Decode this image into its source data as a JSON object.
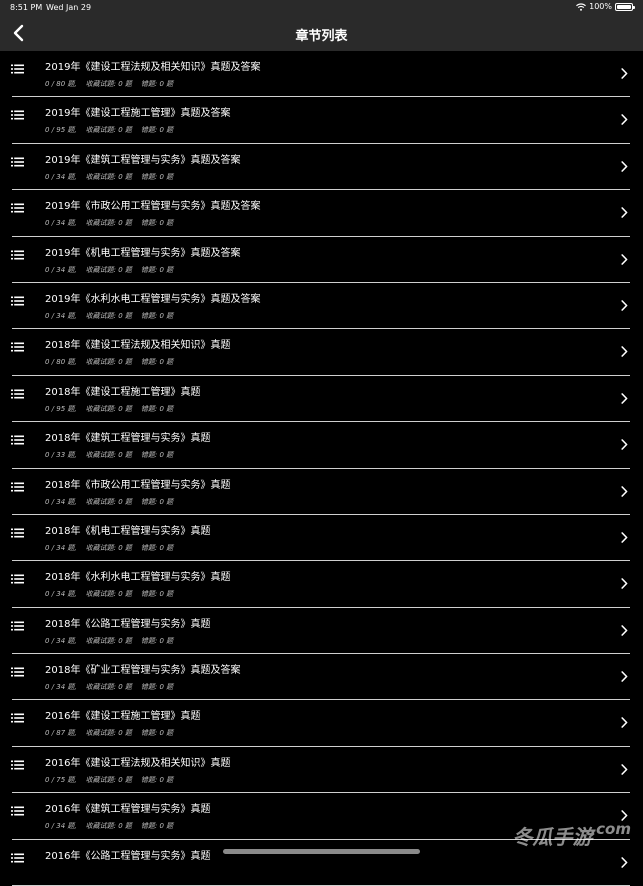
{
  "status_bar": {
    "time": "8:51 PM",
    "date": "Wed Jan 29",
    "battery": "100%",
    "battery_level": 1.0,
    "wifi_icon": "wifi-icon"
  },
  "nav": {
    "title": "章节列表",
    "back_icon": "chevron-left-icon"
  },
  "chapters": [
    {
      "title": "2019年《建设工程法规及相关知识》真题及答案",
      "progress": "0 / 80 题,",
      "favorites": "收藏试题: 0 题",
      "wrong": "错题: 0 题"
    },
    {
      "title": "2019年《建设工程施工管理》真题及答案",
      "progress": "0 / 95 题,",
      "favorites": "收藏试题: 0 题",
      "wrong": "错题: 0 题"
    },
    {
      "title": "2019年《建筑工程管理与实务》真题及答案",
      "progress": "0 / 34 题,",
      "favorites": "收藏试题: 0 题",
      "wrong": "错题: 0 题"
    },
    {
      "title": "2019年《市政公用工程管理与实务》真题及答案",
      "progress": "0 / 34 题,",
      "favorites": "收藏试题: 0 题",
      "wrong": "错题: 0 题"
    },
    {
      "title": "2019年《机电工程管理与实务》真题及答案",
      "progress": "0 / 34 题,",
      "favorites": "收藏试题: 0 题",
      "wrong": "错题: 0 题"
    },
    {
      "title": "2019年《水利水电工程管理与实务》真题及答案",
      "progress": "0 / 34 题,",
      "favorites": "收藏试题: 0 题",
      "wrong": "错题: 0 题"
    },
    {
      "title": "2018年《建设工程法规及相关知识》真题",
      "progress": "0 / 80 题,",
      "favorites": "收藏试题: 0 题",
      "wrong": "错题: 0 题"
    },
    {
      "title": "2018年《建设工程施工管理》真题",
      "progress": "0 / 95 题,",
      "favorites": "收藏试题: 0 题",
      "wrong": "错题: 0 题"
    },
    {
      "title": "2018年《建筑工程管理与实务》真题",
      "progress": "0 / 33 题,",
      "favorites": "收藏试题: 0 题",
      "wrong": "错题: 0 题"
    },
    {
      "title": "2018年《市政公用工程管理与实务》真题",
      "progress": "0 / 34 题,",
      "favorites": "收藏试题: 0 题",
      "wrong": "错题: 0 题"
    },
    {
      "title": "2018年《机电工程管理与实务》真题",
      "progress": "0 / 34 题,",
      "favorites": "收藏试题: 0 题",
      "wrong": "错题: 0 题"
    },
    {
      "title": "2018年《水利水电工程管理与实务》真题",
      "progress": "0 / 34 题,",
      "favorites": "收藏试题: 0 题",
      "wrong": "错题: 0 题"
    },
    {
      "title": "2018年《公路工程管理与实务》真题",
      "progress": "0 / 34 题,",
      "favorites": "收藏试题: 0 题",
      "wrong": "错题: 0 题"
    },
    {
      "title": "2018年《矿业工程管理与实务》真题及答案",
      "progress": "0 / 34 题,",
      "favorites": "收藏试题: 0 题",
      "wrong": "错题: 0 题"
    },
    {
      "title": "2016年《建设工程施工管理》真题",
      "progress": "0 / 87 题,",
      "favorites": "收藏试题: 0 题",
      "wrong": "错题: 0 题"
    },
    {
      "title": "2016年《建设工程法规及相关知识》真题",
      "progress": "0 / 75 题,",
      "favorites": "收藏试题: 0 题",
      "wrong": "错题: 0 题"
    },
    {
      "title": "2016年《建筑工程管理与实务》真题",
      "progress": "0 / 34 题,",
      "favorites": "收藏试题: 0 题",
      "wrong": "错题: 0 题"
    },
    {
      "title": "2016年《公路工程管理与实务》真题",
      "progress": "",
      "favorites": "",
      "wrong": ""
    }
  ],
  "watermark": {
    "brand": "冬瓜手游",
    "domain": ".com"
  }
}
